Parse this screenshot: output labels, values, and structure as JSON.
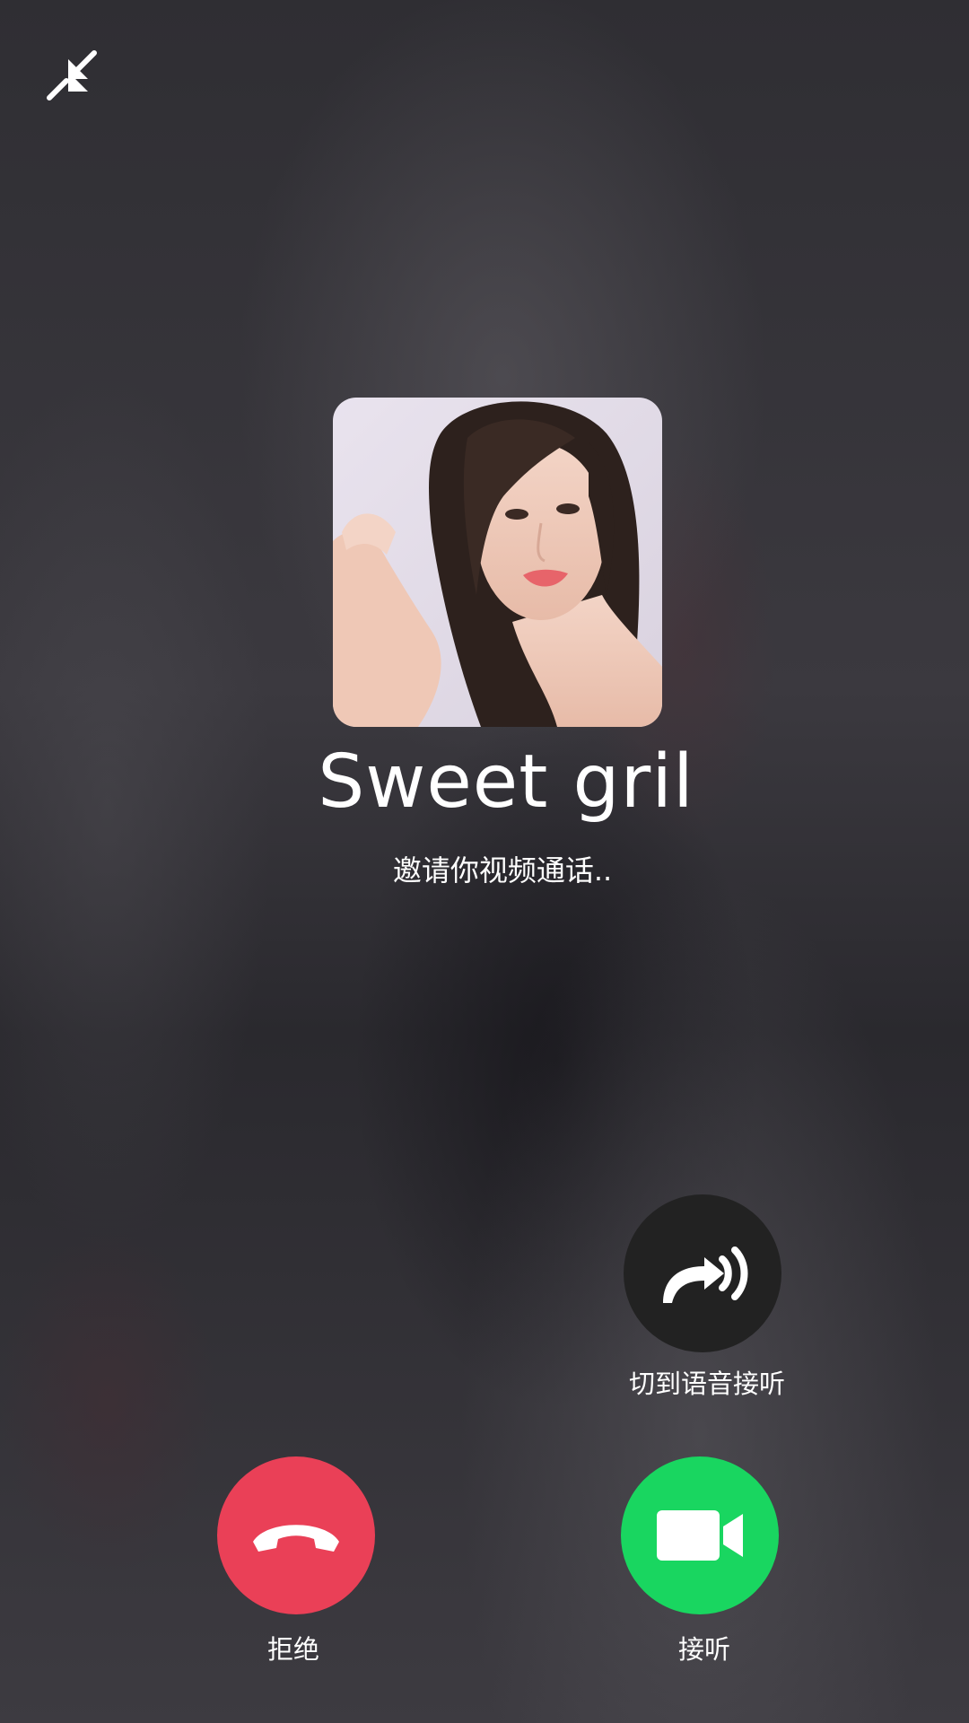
{
  "call": {
    "caller_name": "Sweet gril",
    "status_text": "邀请你视频通话.."
  },
  "actions": {
    "switch_voice_label": "切到语音接听",
    "decline_label": "拒绝",
    "accept_label": "接听"
  },
  "icons": {
    "minimize": "minimize-arrows-icon",
    "switch_voice": "voice-forward-icon",
    "decline": "phone-hangup-icon",
    "accept": "video-camera-icon"
  },
  "colors": {
    "decline": "#ea4057",
    "accept": "#19d660",
    "voice_button": "#222222"
  }
}
